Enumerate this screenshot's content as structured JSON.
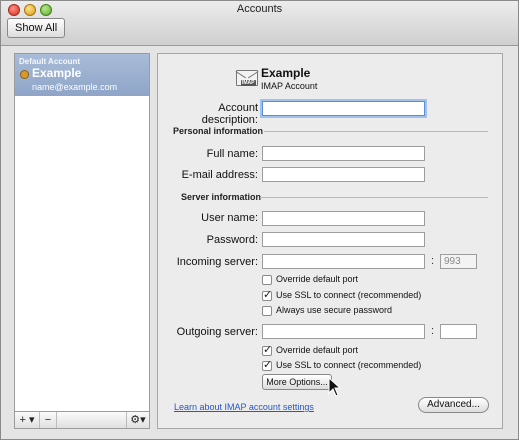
{
  "window": {
    "title": "Accounts"
  },
  "toolbar": {
    "show_all_label": "Show All"
  },
  "accounts": [
    {
      "category": "Default Account",
      "name": "Example",
      "email": "name@example.com"
    }
  ],
  "list_toolbar": {
    "add_label": "+ ▾",
    "remove_label": "−",
    "gear_label": "⚙▾"
  },
  "header": {
    "name": "Example",
    "type": "IMAP Account",
    "badge": "IMAP"
  },
  "form": {
    "account_description": {
      "label": "Account description:",
      "value": ""
    },
    "personal_section": "Personal information",
    "full_name": {
      "label": "Full name:",
      "value": ""
    },
    "email_address": {
      "label": "E-mail address:",
      "value": ""
    },
    "server_section": "Server information",
    "user_name": {
      "label": "User name:",
      "value": ""
    },
    "password": {
      "label": "Password:",
      "value": ""
    },
    "incoming_server": {
      "label": "Incoming server:",
      "value": "",
      "port": "993"
    },
    "incoming_options": {
      "override_port": {
        "label": "Override default port",
        "checked": false
      },
      "use_ssl": {
        "label": "Use SSL to connect (recommended)",
        "checked": true
      },
      "secure_password": {
        "label": "Always use secure password",
        "checked": false
      }
    },
    "outgoing_server": {
      "label": "Outgoing server:",
      "value": "",
      "port": ""
    },
    "outgoing_options": {
      "override_port": {
        "label": "Override default port",
        "checked": true
      },
      "use_ssl": {
        "label": "Use SSL to connect (recommended)",
        "checked": true
      }
    },
    "colon": ":",
    "more_options_label": "More Options...",
    "learn_link": "Learn about IMAP account settings",
    "advanced_label": "Advanced..."
  },
  "icons": {
    "close": "close-icon",
    "minimize": "minimize-icon",
    "zoom": "zoom-icon",
    "account": "lock-icon",
    "mail": "envelope-icon",
    "gear": "gear-icon",
    "cursor": "pointer-cursor-icon"
  },
  "colors": {
    "selection": "#9cb1d2",
    "link": "#2457c7",
    "focus": "#5a8fd6"
  }
}
